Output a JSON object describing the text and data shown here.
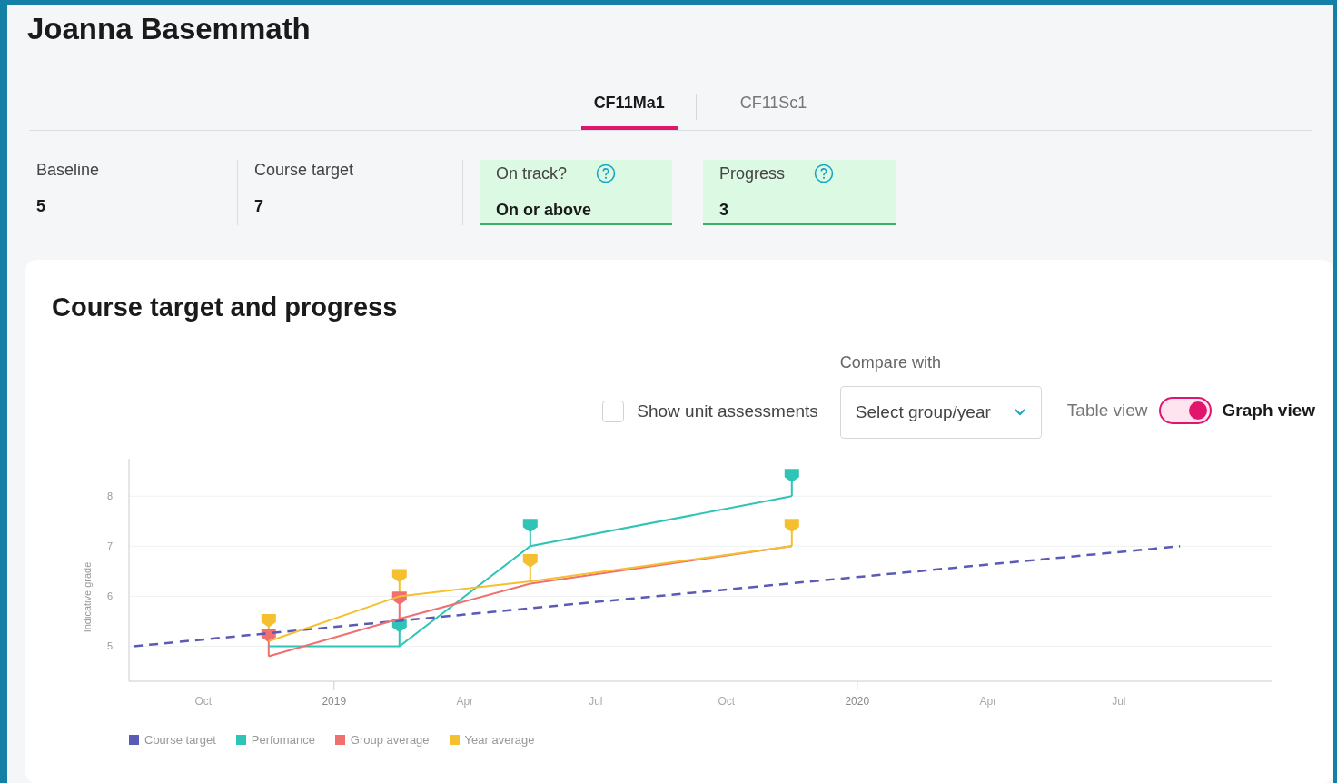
{
  "student_name": "Joanna Basemmath",
  "tabs": [
    {
      "label": "CF11Ma1",
      "selected": true
    },
    {
      "label": "CF11Sc1",
      "selected": false
    }
  ],
  "stats": [
    {
      "label": "Baseline",
      "value": "5",
      "highlighted": false,
      "help": false
    },
    {
      "label": "Course target",
      "value": "7",
      "highlighted": false,
      "help": false
    },
    {
      "label": "On track?",
      "value": "On or above",
      "highlighted": true,
      "help": true
    },
    {
      "label": "Progress",
      "value": "3",
      "highlighted": true,
      "help": true
    }
  ],
  "card": {
    "title": "Course target and progress",
    "show_unit_assessments": {
      "label": "Show unit assessments",
      "checked": false
    },
    "compare": {
      "label": "Compare with",
      "placeholder": "Select group/year"
    },
    "view_toggle": {
      "off_label": "Table view",
      "on_label": "Graph view",
      "on": true
    },
    "chart_data": {
      "type": "line",
      "ylabel": "Indicative grade",
      "grid": true,
      "legend": true,
      "x": [
        2018.617,
        2018.875,
        2019.125,
        2019.375,
        2019.875,
        2020.617
      ],
      "series": [
        {
          "name": "Course target",
          "color": "#5b5bb5",
          "line_style": "dashed",
          "values": [
            5,
            5.26,
            5.51,
            5.76,
            6.26,
            7
          ]
        },
        {
          "name": "Perfomance",
          "color": "#2ec4b6",
          "values": [
            null,
            5,
            5,
            7,
            8,
            null
          ]
        },
        {
          "name": "Group average",
          "color": "#f07070",
          "values": [
            null,
            4.8,
            5.55,
            6.25,
            7,
            null
          ]
        },
        {
          "name": "Year average",
          "color": "#f5c030",
          "values": [
            null,
            5.1,
            6,
            6.3,
            7,
            null
          ]
        }
      ],
      "xlim": [
        2018.608,
        2020.792
      ],
      "ylim": [
        4.3,
        8.75
      ],
      "xticks": [
        {
          "value": 2018.75,
          "label": "Oct"
        },
        2019,
        {
          "value": 2019.25,
          "label": "Apr"
        },
        {
          "value": 2019.5,
          "label": "Jul"
        },
        {
          "value": 2019.75,
          "label": "Oct"
        },
        2020,
        {
          "value": 2020.25,
          "label": "Apr"
        },
        {
          "value": 2020.5,
          "label": "Jul"
        }
      ],
      "yticks": [
        5,
        6,
        7,
        8
      ]
    }
  }
}
